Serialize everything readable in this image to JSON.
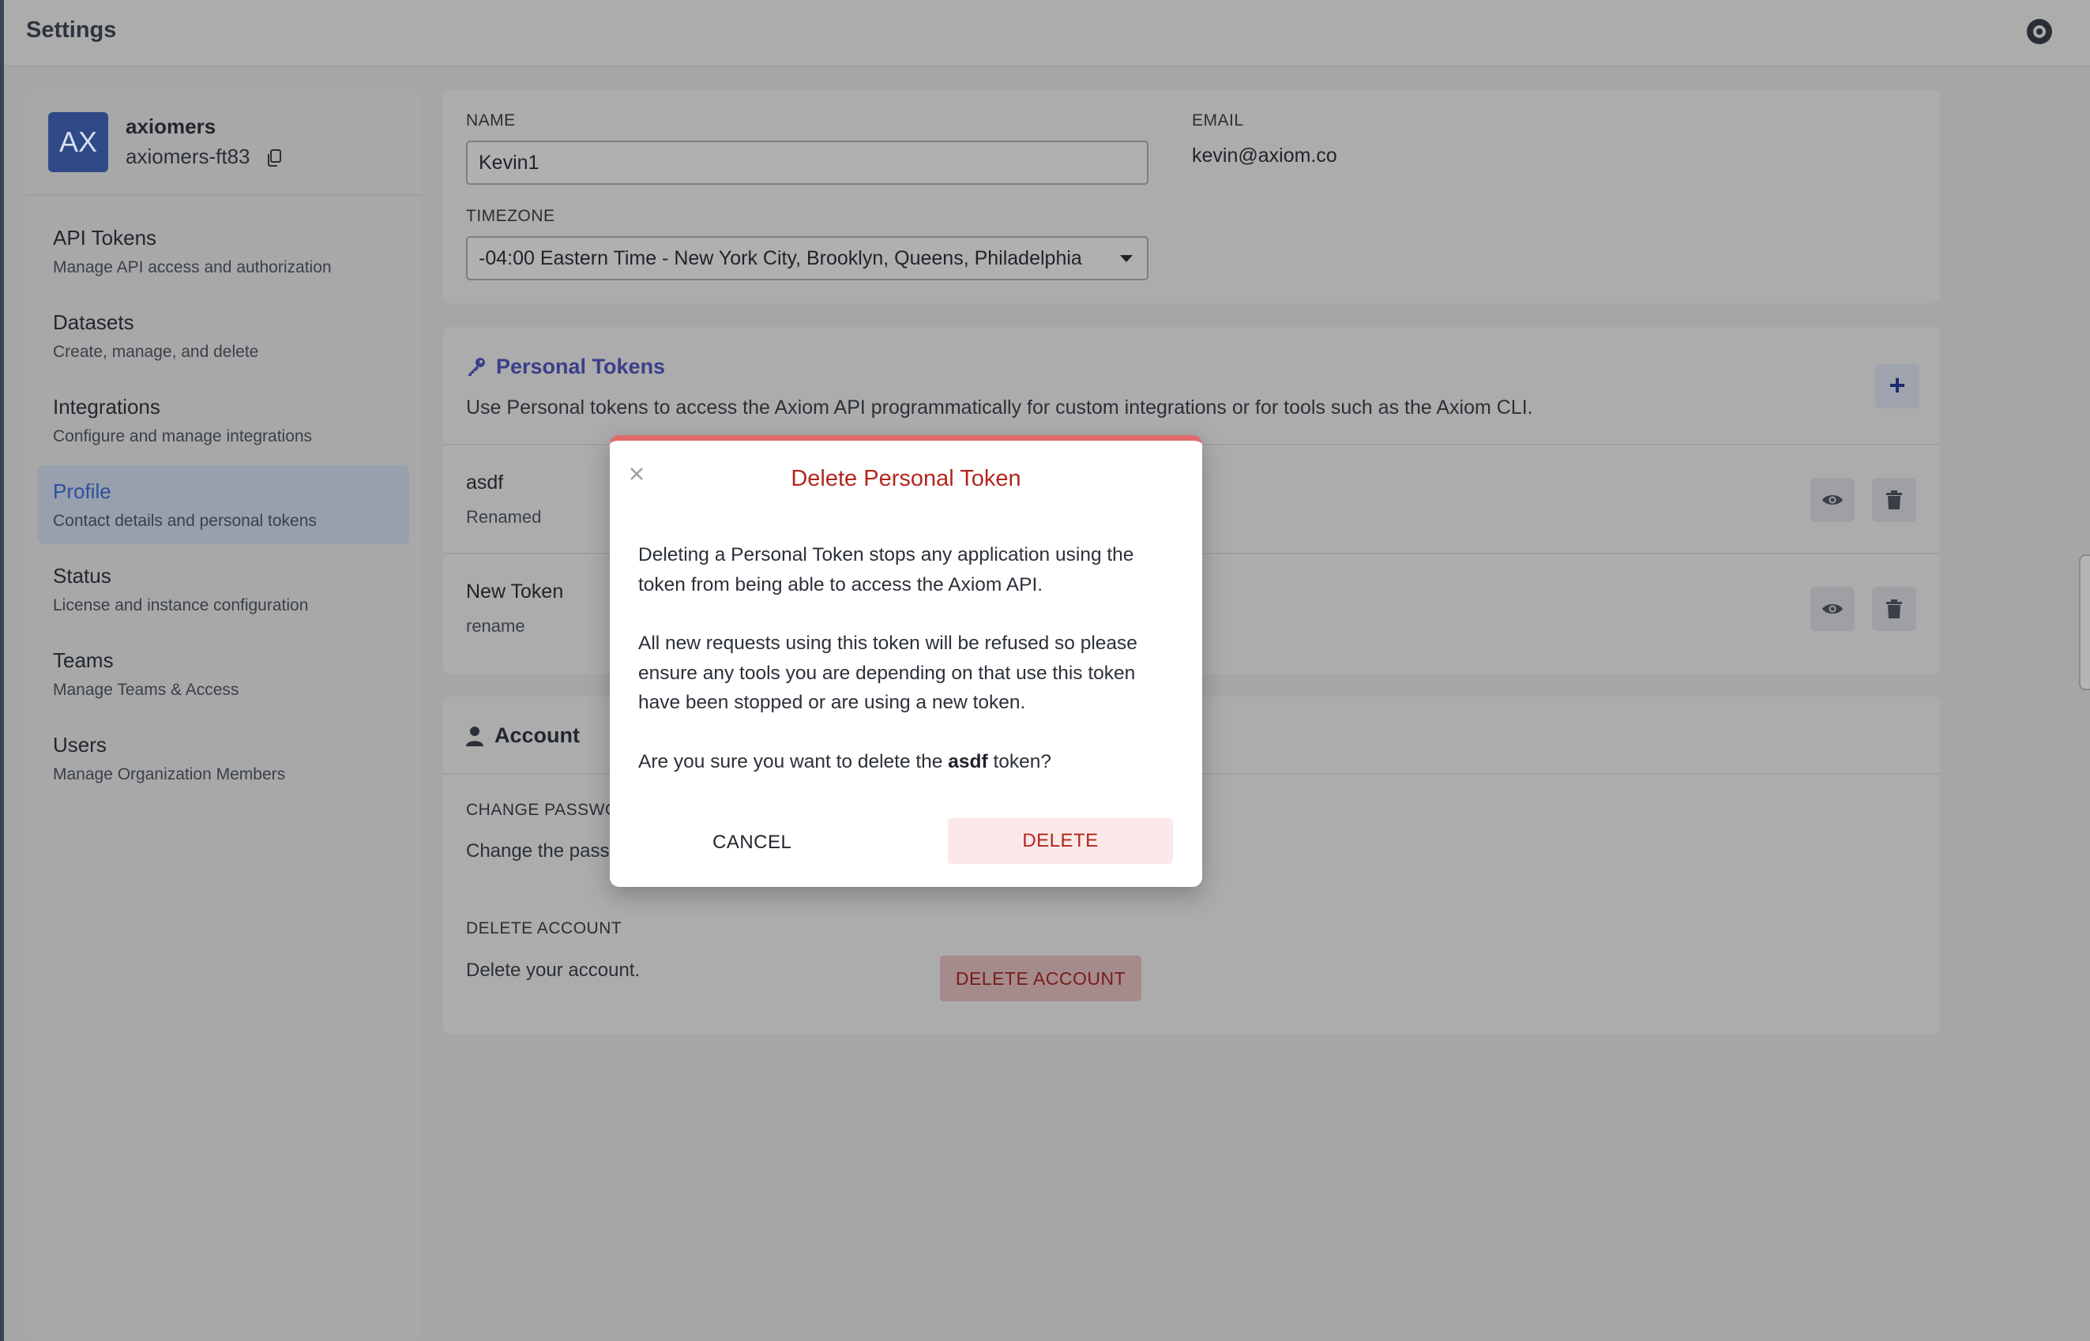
{
  "header": {
    "title": "Settings",
    "help_icon": "help-lifebuoy-icon"
  },
  "org": {
    "avatar_initials": "AX",
    "name": "axiomers",
    "id": "axiomers-ft83"
  },
  "sidebar": {
    "items": [
      {
        "label": "API Tokens",
        "desc": "Manage API access and authorization"
      },
      {
        "label": "Datasets",
        "desc": "Create, manage, and delete"
      },
      {
        "label": "Integrations",
        "desc": "Configure and manage integrations"
      },
      {
        "label": "Profile",
        "desc": "Contact details and personal tokens"
      },
      {
        "label": "Status",
        "desc": "License and instance configuration"
      },
      {
        "label": "Teams",
        "desc": "Manage Teams & Access"
      },
      {
        "label": "Users",
        "desc": "Manage Organization Members"
      }
    ],
    "active": "Profile"
  },
  "profile": {
    "name_label": "NAME",
    "name_value": "Kevin1",
    "email_label": "EMAIL",
    "email_value": "kevin@axiom.co",
    "timezone_label": "TIMEZONE",
    "timezone_value": "-04:00 Eastern Time - New York City, Brooklyn, Queens, Philadelphia"
  },
  "tokens": {
    "title": "Personal Tokens",
    "description": "Use Personal tokens to access the Axiom API programmatically for custom integrations or for tools such as the Axiom CLI.",
    "add_label": "+",
    "items": [
      {
        "name": "asdf",
        "desc": "Renamed"
      },
      {
        "name": "New Token",
        "desc": "rename"
      }
    ]
  },
  "account": {
    "title": "Account",
    "change_password_label": "CHANGE PASSWO",
    "change_password_text": "Change the pass",
    "delete_label": "DELETE ACCOUNT",
    "delete_text": "Delete your account.",
    "delete_button": "DELETE ACCOUNT"
  },
  "modal": {
    "title": "Delete Personal Token",
    "para1": "Deleting a Personal Token stops any application using the token from being able to access the Axiom API.",
    "para2": "All new requests using this token will be refused so please ensure any tools you are depending on that use this token have been stopped or are using a new token.",
    "confirm_prefix": "Are you sure you want to delete the ",
    "confirm_token": "asdf",
    "confirm_suffix": " token?",
    "cancel_label": "CANCEL",
    "delete_label": "DELETE"
  },
  "colors": {
    "accent": "#3a3f8a",
    "danger": "#b3261e",
    "modal_top_border": "#e06a6a"
  }
}
